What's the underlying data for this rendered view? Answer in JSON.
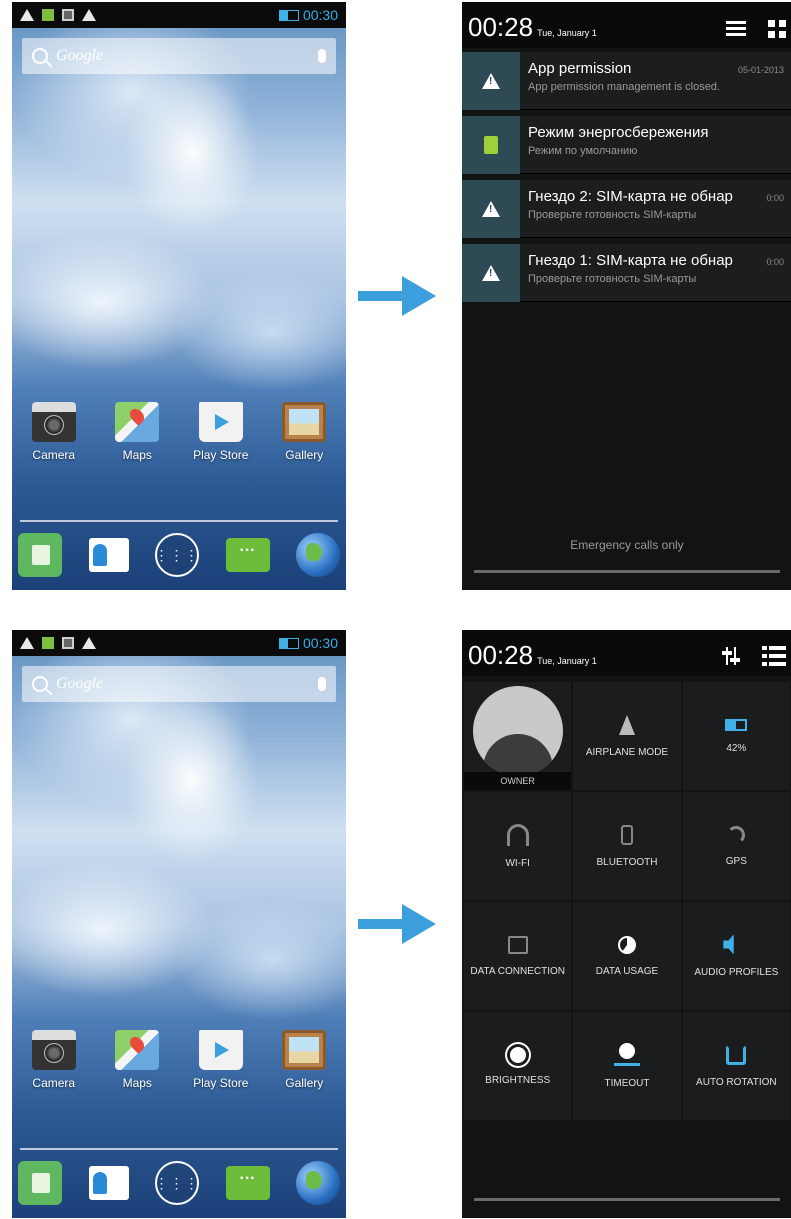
{
  "home_screen": {
    "status_time": "00:30",
    "search_label": "Google",
    "apps": [
      {
        "label": "Camera",
        "icon": "camera-icon"
      },
      {
        "label": "Maps",
        "icon": "maps-icon"
      },
      {
        "label": "Play Store",
        "icon": "play-store-icon"
      },
      {
        "label": "Gallery",
        "icon": "gallery-icon"
      }
    ],
    "dock": [
      "phone-icon",
      "contacts-icon",
      "app-drawer-icon",
      "messaging-icon",
      "browser-globe-icon"
    ],
    "drawer_glyph": "⋮⋮⋮",
    "sms_glyph": "···"
  },
  "notification_shade": {
    "time": "00:28",
    "date": "Tue, January 1",
    "notifications": [
      {
        "title": "App permission",
        "time": "05-01-2013",
        "subtitle": "App permission management is closed.",
        "icon": "warning-icon"
      },
      {
        "title": "Режим энергосбережения",
        "time": "",
        "subtitle": "Режим по умолчанию",
        "icon": "sim-card-icon"
      },
      {
        "title": "Гнездо 2: SIM-карта не обнар",
        "time": "0:00",
        "subtitle": "Проверьте готовность SIM-карты",
        "icon": "warning-icon"
      },
      {
        "title": "Гнездо 1: SIM-карта не обнар",
        "time": "0:00",
        "subtitle": "Проверьте готовность SIM-карты",
        "icon": "warning-icon"
      }
    ],
    "footer": "Emergency calls only"
  },
  "quick_settings": {
    "time": "00:28",
    "date": "Tue, January 1",
    "tiles": [
      {
        "label": "OWNER",
        "icon": "owner-avatar-icon"
      },
      {
        "label": "AIRPLANE MODE",
        "icon": "airplane-icon"
      },
      {
        "label": "42%",
        "icon": "battery-icon"
      },
      {
        "label": "WI-FI",
        "icon": "wifi-icon"
      },
      {
        "label": "BLUETOOTH",
        "icon": "bluetooth-icon"
      },
      {
        "label": "GPS",
        "icon": "gps-icon"
      },
      {
        "label": "DATA CONNECTION",
        "icon": "data-connection-icon"
      },
      {
        "label": "DATA USAGE",
        "icon": "data-usage-icon"
      },
      {
        "label": "AUDIO PROFILES",
        "icon": "audio-profiles-icon"
      },
      {
        "label": "BRIGHTNESS",
        "icon": "brightness-icon"
      },
      {
        "label": "TIMEOUT",
        "icon": "timeout-icon"
      },
      {
        "label": "AUTO ROTATION",
        "icon": "auto-rotation-icon"
      }
    ]
  },
  "colors": {
    "accent_blue": "#36aee9",
    "arrow_blue": "#3b9fde",
    "shade_bg": "#121314",
    "notif_icon_bg": "#2d4a55"
  }
}
